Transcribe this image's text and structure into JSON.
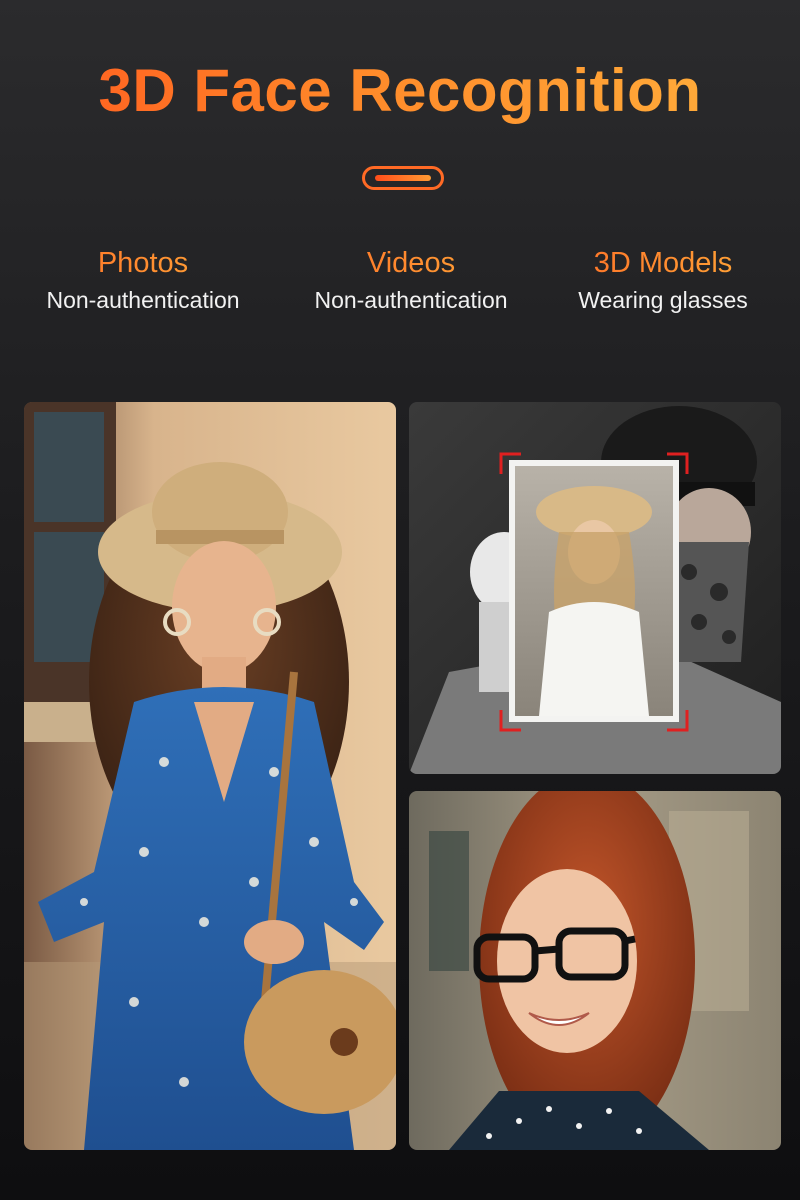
{
  "header": {
    "title": "3D Face Recognition"
  },
  "features": [
    {
      "title": "Photos",
      "subtitle": "Non-authentication"
    },
    {
      "title": "Videos",
      "subtitle": "Non-authentication"
    },
    {
      "title": "3D Models",
      "subtitle": "Wearing glasses"
    }
  ],
  "colors": {
    "accent_start": "#ff5a1f",
    "accent_end": "#ffb23d",
    "text_light": "#f2f2f2",
    "background": "#1c1c1e"
  },
  "images": [
    {
      "name": "woman-in-hat-photo"
    },
    {
      "name": "person-holding-photo-spoof"
    },
    {
      "name": "woman-with-glasses-photo"
    }
  ]
}
